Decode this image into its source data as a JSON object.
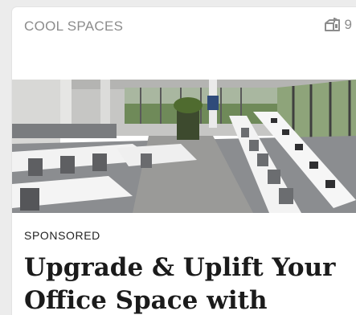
{
  "card": {
    "category": "COOL SPACES",
    "count": "9",
    "count_icon": "mailbox-icon",
    "image_alt": "Open-plan office with rows of white desks, grey task chairs and large windows",
    "sponsored_label": "SPONSORED",
    "headline": "Upgrade & Uplift Your Office Space with"
  },
  "colors": {
    "page_background": "#ececec",
    "card_background": "#ffffff",
    "muted_text": "#8c8c8c",
    "headline_text": "#1b1b1b"
  }
}
